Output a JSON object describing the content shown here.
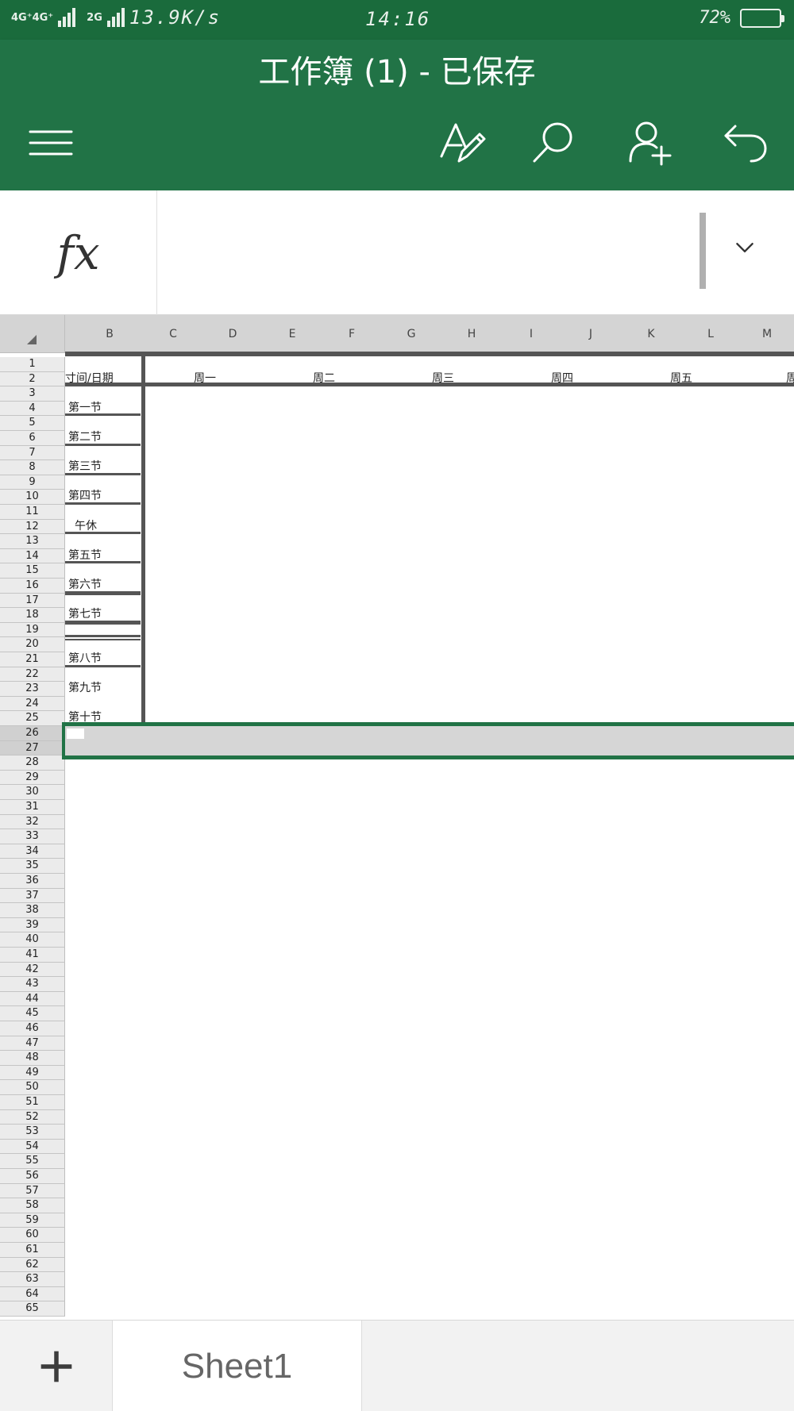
{
  "status_bar": {
    "network_1": "4G⁺4G⁺",
    "network_2": "2G",
    "speed": "13.9K/s",
    "time": "14:16",
    "battery_pct": "72%",
    "battery_level": 0.72
  },
  "app": {
    "title": "工作簿 (1) - 已保存",
    "accent_color": "#217346"
  },
  "toolbar": {
    "menu_icon": "hamburger-menu-icon",
    "edit_icon": "text-edit-icon",
    "search_icon": "search-icon",
    "share_icon": "add-person-icon",
    "undo_icon": "undo-icon"
  },
  "formula_bar": {
    "fx_label": "fx",
    "value": ""
  },
  "grid": {
    "columns": [
      "B",
      "C",
      "D",
      "E",
      "F",
      "G",
      "H",
      "I",
      "J",
      "K",
      "L",
      "M"
    ],
    "rows": [
      "1",
      "2",
      "3",
      "4",
      "5",
      "6",
      "7",
      "8",
      "9",
      "10",
      "11",
      "12",
      "13",
      "14",
      "15",
      "16",
      "17",
      "18",
      "19",
      "20",
      "21",
      "22",
      "23",
      "24",
      "25",
      "26",
      "27",
      "28",
      "29",
      "30",
      "31",
      "32",
      "33",
      "34",
      "35",
      "36",
      "37",
      "38",
      "39",
      "40",
      "41",
      "42",
      "43",
      "44",
      "45",
      "46",
      "47",
      "48",
      "49",
      "50",
      "51",
      "52",
      "53",
      "54",
      "55",
      "56",
      "57",
      "58",
      "59",
      "60",
      "61",
      "62",
      "63",
      "64",
      "65"
    ],
    "selected_rows": [
      "26",
      "27"
    ],
    "header_cell": "寸间/日期",
    "day_headers": [
      "周一",
      "周二",
      "周三",
      "周四",
      "周五",
      "周"
    ],
    "periods": [
      "第一节",
      "第二节",
      "第三节",
      "第四节",
      "午休",
      "第五节",
      "第六节",
      "第七节",
      "第八节",
      "第九节",
      "第十节"
    ]
  },
  "sheets": {
    "add_icon": "plus-icon",
    "tabs": [
      "Sheet1"
    ]
  }
}
